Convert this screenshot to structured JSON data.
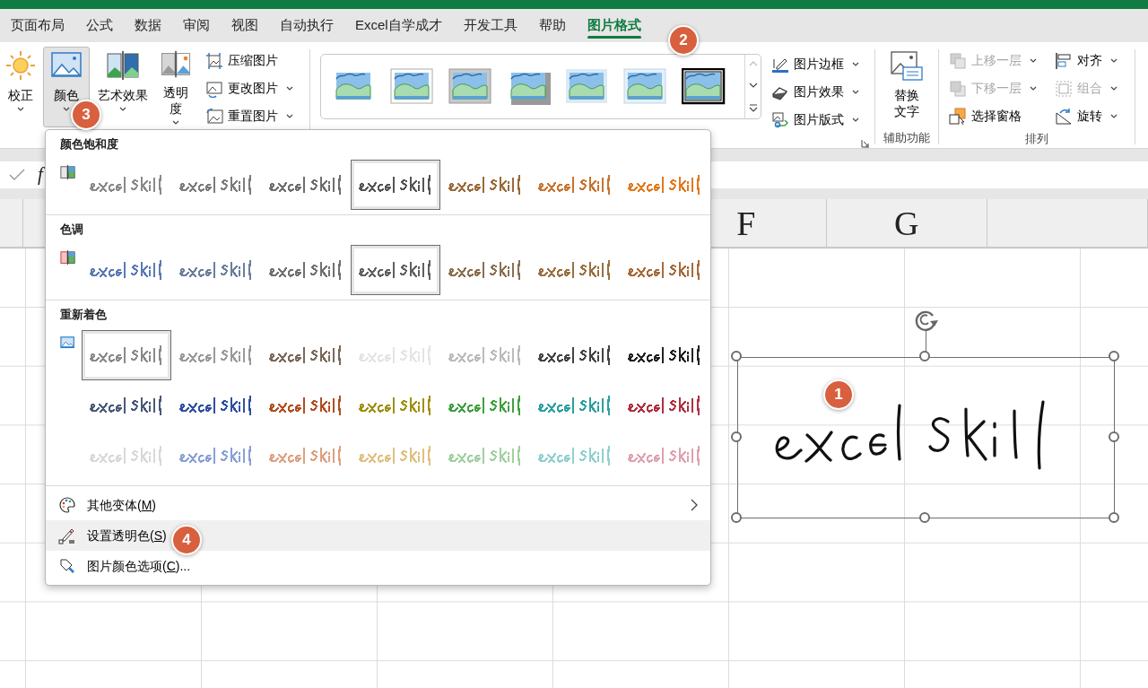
{
  "ribbon_tabs": [
    {
      "label": "页面布局",
      "selected": false
    },
    {
      "label": "公式",
      "selected": false
    },
    {
      "label": "数据",
      "selected": false
    },
    {
      "label": "审阅",
      "selected": false
    },
    {
      "label": "视图",
      "selected": false
    },
    {
      "label": "自动执行",
      "selected": false
    },
    {
      "label": "Excel自学成才",
      "selected": false
    },
    {
      "label": "开发工具",
      "selected": false
    },
    {
      "label": "帮助",
      "selected": false
    },
    {
      "label": "图片格式",
      "selected": true
    }
  ],
  "ribbon": {
    "adjust": {
      "big_buttons": [
        {
          "label": "校正",
          "dropdown": true,
          "selected": false
        },
        {
          "label": "颜色",
          "dropdown": true,
          "selected": true
        },
        {
          "label": "艺术效果",
          "dropdown": true,
          "selected": false
        },
        {
          "label": "透明度",
          "dropdown": true,
          "selected": false
        }
      ],
      "small_buttons": [
        {
          "label": "压缩图片",
          "dropdown": false
        },
        {
          "label": "更改图片",
          "dropdown": true
        },
        {
          "label": "重置图片",
          "dropdown": true
        }
      ]
    },
    "styles": {
      "gallery": [
        {
          "kind": "simple"
        },
        {
          "kind": "white-frame"
        },
        {
          "kind": "gray-frame"
        },
        {
          "kind": "shadow"
        },
        {
          "kind": "soft-edge"
        },
        {
          "kind": "glow"
        },
        {
          "kind": "black-frame"
        }
      ],
      "buttons": [
        {
          "label": "图片边框",
          "dropdown": true
        },
        {
          "label": "图片效果",
          "dropdown": true
        },
        {
          "label": "图片版式",
          "dropdown": true
        }
      ]
    },
    "accessibility": {
      "button": {
        "label": "替换文字"
      },
      "group_label": "辅助功能"
    },
    "arrange": {
      "buttons": [
        {
          "label": "上移一层",
          "dropdown": true,
          "disabled": true
        },
        {
          "label": "下移一层",
          "dropdown": true,
          "disabled": true
        },
        {
          "label": "选择窗格",
          "dropdown": false,
          "disabled": false
        },
        {
          "label": "对齐",
          "dropdown": true,
          "disabled": false
        },
        {
          "label": "组合",
          "dropdown": true,
          "disabled": true
        },
        {
          "label": "旋转",
          "dropdown": true,
          "disabled": false
        }
      ],
      "group_label": "排列"
    }
  },
  "formula_bar": {
    "function_label": "f"
  },
  "sheet": {
    "column_headers": [
      "F",
      "G"
    ]
  },
  "color_menu": {
    "sections": [
      {
        "title": "颜色饱和度",
        "rows": [
          [
            {
              "color": "#8a8a8a",
              "selected": false
            },
            {
              "color": "#7c7c7c",
              "selected": false
            },
            {
              "color": "#6e6e6e",
              "selected": false
            },
            {
              "color": "#555555",
              "selected": true
            },
            {
              "color": "#9b6a3a",
              "selected": false
            },
            {
              "color": "#c8742e",
              "selected": false
            },
            {
              "color": "#e07a20",
              "selected": false
            }
          ]
        ]
      },
      {
        "title": "色调",
        "rows": [
          [
            {
              "color": "#5a7bb5",
              "selected": false
            },
            {
              "color": "#6a7f9e",
              "selected": false
            },
            {
              "color": "#707070",
              "selected": false
            },
            {
              "color": "#606060",
              "selected": true
            },
            {
              "color": "#8a7050",
              "selected": false
            },
            {
              "color": "#9a7040",
              "selected": false
            },
            {
              "color": "#a86a3a",
              "selected": false
            }
          ]
        ]
      },
      {
        "title": "重新着色",
        "rows": [
          [
            {
              "color": "#8a8a8a",
              "selected": true
            },
            {
              "color": "#9a9a9a",
              "selected": false
            },
            {
              "color": "#7a6a5a",
              "selected": false
            },
            {
              "color": "#e4e4e4",
              "selected": false
            },
            {
              "color": "#bbbbbb",
              "selected": false
            },
            {
              "color": "#444444",
              "selected": false
            },
            {
              "color": "#222222",
              "selected": false
            }
          ],
          [
            {
              "color": "#4a5a7a",
              "selected": false
            },
            {
              "color": "#3050a0",
              "selected": false
            },
            {
              "color": "#b05020",
              "selected": false
            },
            {
              "color": "#a09010",
              "selected": false
            },
            {
              "color": "#40a040",
              "selected": false
            },
            {
              "color": "#2aa0a0",
              "selected": false
            },
            {
              "color": "#b03040",
              "selected": false
            }
          ],
          [
            {
              "color": "#d8d8d8",
              "selected": false
            },
            {
              "color": "#8aa0d8",
              "selected": false
            },
            {
              "color": "#e0a080",
              "selected": false
            },
            {
              "color": "#e0c080",
              "selected": false
            },
            {
              "color": "#a0d0a0",
              "selected": false
            },
            {
              "color": "#90d0d0",
              "selected": false
            },
            {
              "color": "#e0a0b0",
              "selected": false
            }
          ]
        ]
      }
    ],
    "items": [
      {
        "label_parts": [
          "其他变体(",
          "M",
          ")"
        ],
        "submenu": true,
        "highlighted": false
      },
      {
        "label_parts": [
          "设置透明色(",
          "S",
          ")"
        ],
        "submenu": false,
        "highlighted": true
      },
      {
        "label_parts": [
          "图片颜色选项(",
          "C",
          ")..."
        ],
        "submenu": false,
        "highlighted": false
      }
    ]
  },
  "callouts": [
    "1",
    "2",
    "3",
    "4"
  ]
}
